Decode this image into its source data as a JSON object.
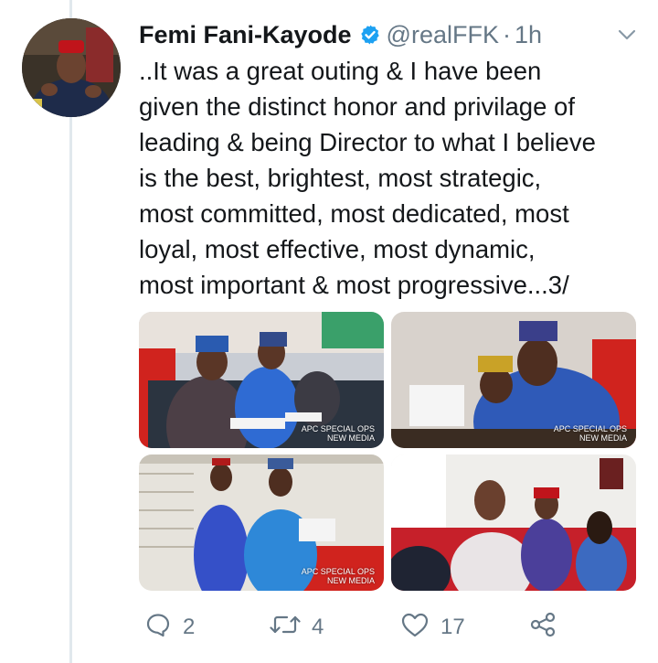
{
  "tweet": {
    "author_name": "Femi Fani-Kayode",
    "handle": "@realFFK",
    "separator": "·",
    "time": "1h",
    "text": "..It was a great outing & I have been\ngiven the distinct honor and privilage of\nleading & being Director to what I believe\nis the best, brightest, most strategic,\nmost committed, most dedicated, most\nloyal, most effective, most dynamic,\nmost important & most progressive...3/"
  },
  "photos": [
    {
      "watermark_line1": "APC SPECIAL OPS",
      "watermark_line2": "NEW MEDIA"
    },
    {
      "watermark_line1": "APC SPECIAL OPS",
      "watermark_line2": "NEW MEDIA"
    },
    {
      "watermark_line1": "APC SPECIAL OPS",
      "watermark_line2": "NEW MEDIA"
    },
    {
      "watermark_line1": "",
      "watermark_line2": ""
    }
  ],
  "actions": {
    "replies": "2",
    "retweets": "4",
    "likes": "17"
  },
  "icons": [
    "verified-badge-icon",
    "chevron-down-icon",
    "reply-icon",
    "retweet-icon",
    "like-icon",
    "share-icon"
  ],
  "colors": {
    "verified": "#1da1f2",
    "muted": "#657786",
    "thread_line": "#e1e8ed"
  }
}
